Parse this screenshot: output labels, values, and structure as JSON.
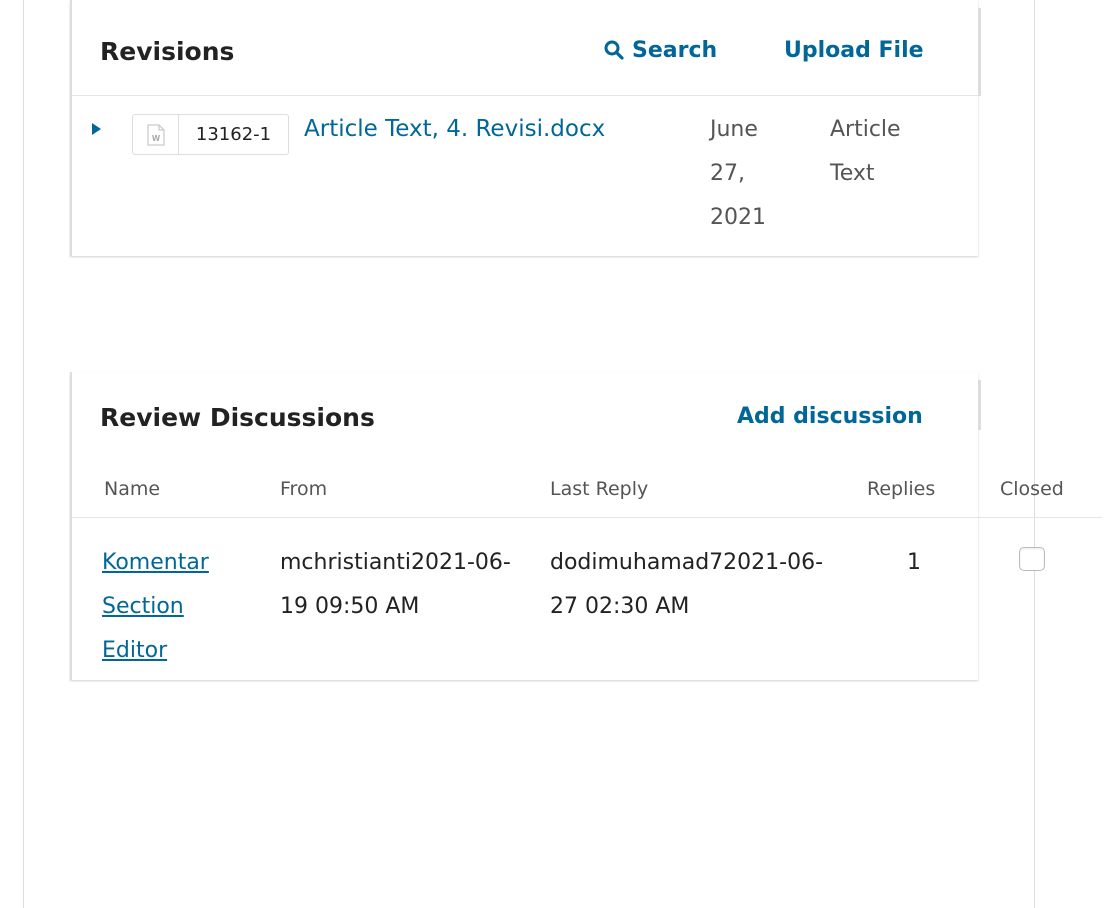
{
  "revisions": {
    "title": "Revisions",
    "search_label": "Search",
    "upload_label": "Upload File",
    "files": [
      {
        "id": "13162-1",
        "name": "Article Text, 4. Revisi.docx",
        "date": "June 27, 2021",
        "type": "Article Text",
        "icon": "word-document-icon"
      }
    ]
  },
  "discussions": {
    "title": "Review Discussions",
    "add_label": "Add discussion",
    "columns": {
      "name": "Name",
      "from": "From",
      "last_reply": "Last Reply",
      "replies": "Replies",
      "closed": "Closed"
    },
    "rows": [
      {
        "name": "Komentar Section Editor",
        "from": "mchristianti2021-06-19 09:50 AM",
        "last_reply": "dodimuhamad72021-06-27 02:30 AM",
        "replies": "1",
        "closed": false
      }
    ]
  },
  "colors": {
    "link": "#006798",
    "text": "#222222",
    "muted": "#555555",
    "border": "#dddddd"
  }
}
